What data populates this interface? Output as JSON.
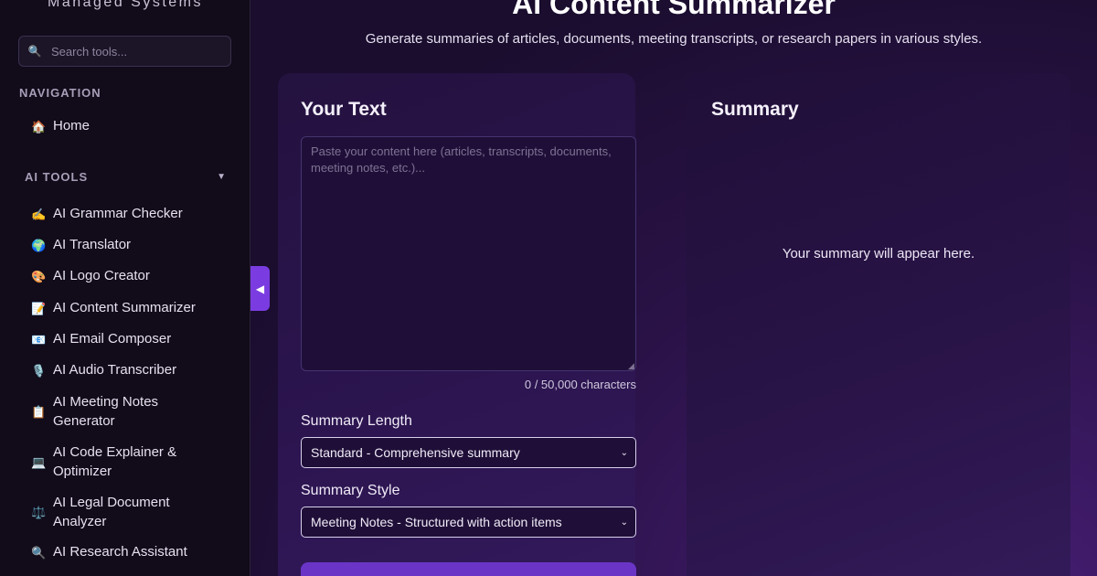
{
  "sidebar": {
    "brand": "Managed Systems",
    "search_placeholder": "Search tools...",
    "search_icon": "magnifier-icon",
    "navigation_label": "NAVIGATION",
    "home": {
      "emoji": "🏠",
      "label": "Home"
    },
    "tools_label": "AI TOOLS",
    "tools_caret": "▼",
    "tools": [
      {
        "emoji": "✍️",
        "label": "AI Grammar Checker"
      },
      {
        "emoji": "🌍",
        "label": "AI Translator"
      },
      {
        "emoji": "🎨",
        "label": "AI Logo Creator"
      },
      {
        "emoji": "📝",
        "label": "AI Content Summarizer"
      },
      {
        "emoji": "📧",
        "label": "AI Email Composer"
      },
      {
        "emoji": "🎙️",
        "label": "AI Audio Transcriber"
      },
      {
        "emoji": "📋",
        "label": "AI Meeting Notes Generator"
      },
      {
        "emoji": "💻",
        "label": "AI Code Explainer & Optimizer"
      },
      {
        "emoji": "⚖️",
        "label": "AI Legal Document Analyzer"
      },
      {
        "emoji": "🔍",
        "label": "AI Research Assistant"
      }
    ],
    "collapse_glyph": "◀"
  },
  "page": {
    "title": "AI Content Summarizer",
    "subtitle": "Generate summaries of articles, documents, meeting transcripts, or research papers in various styles."
  },
  "input_panel": {
    "heading": "Your Text",
    "textarea_placeholder": "Paste your content here (articles, transcripts, documents, meeting notes, etc.)...",
    "textarea_value": "",
    "char_count": "0 / 50,000 characters",
    "length_label": "Summary Length",
    "length_selected": "Standard - Comprehensive summary",
    "style_label": "Summary Style",
    "style_selected": "Meeting Notes - Structured with action items",
    "select_chevron": "⌄"
  },
  "output_panel": {
    "heading": "Summary",
    "placeholder": "Your summary will appear here."
  },
  "colors": {
    "accent": "#7a3ce0",
    "sidebar_bg": "#110b1a",
    "main_bg": "#1a0d2e"
  }
}
